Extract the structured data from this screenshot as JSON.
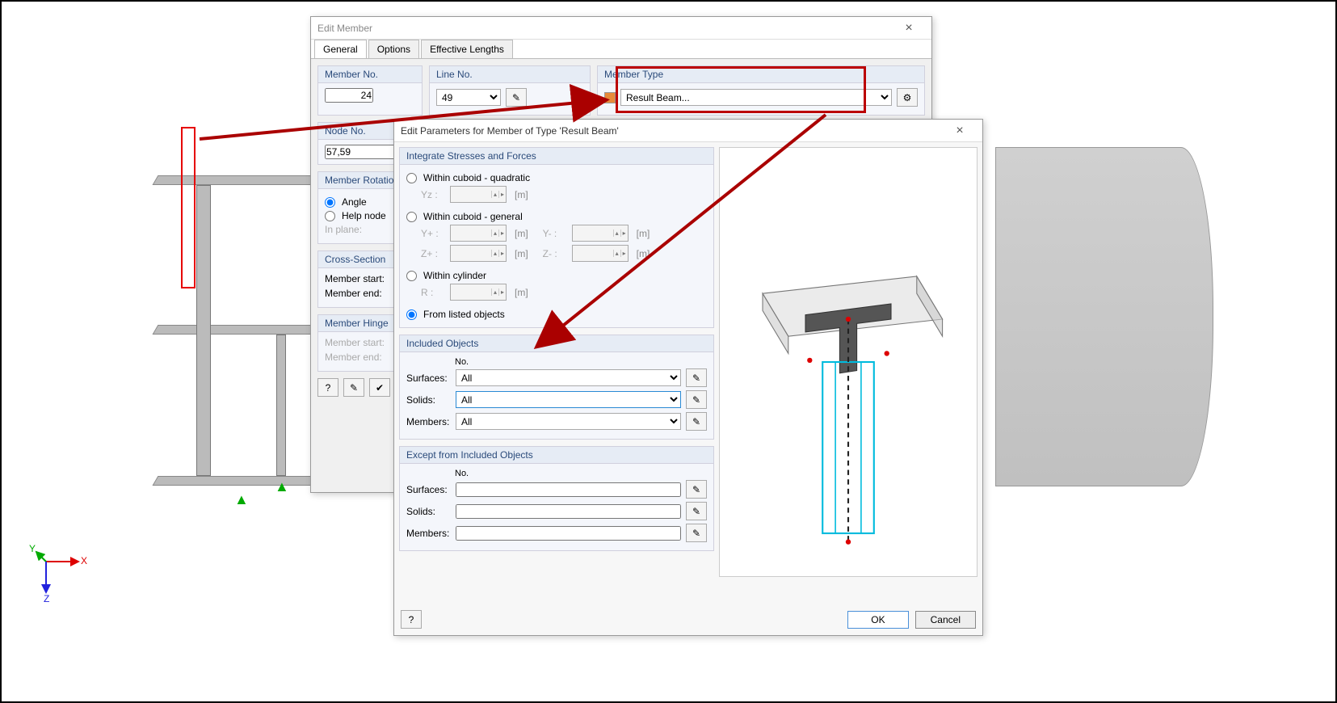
{
  "editMember": {
    "title": "Edit Member",
    "tabs": {
      "general": "General",
      "options": "Options",
      "effective": "Effective Lengths"
    },
    "memberNo": {
      "label": "Member No.",
      "value": "24"
    },
    "lineNo": {
      "label": "Line No.",
      "value": "49"
    },
    "memberType": {
      "label": "Member Type",
      "value": "Result Beam..."
    },
    "nodeNo": {
      "label": "Node No.",
      "value": "57,59"
    },
    "rotation": {
      "title": "Member Rotation",
      "angle": "Angle",
      "helpNode": "Help node",
      "inPlane": "In plane:"
    },
    "crossSection": {
      "title": "Cross-Section",
      "start": "Member start:",
      "end": "Member end:"
    },
    "hinge": {
      "title": "Member Hinge",
      "start": "Member start:",
      "end": "Member end:"
    }
  },
  "editParams": {
    "title": "Edit Parameters for Member of Type 'Result Beam'",
    "integrate": {
      "title": "Integrate Stresses and Forces",
      "quadratic": "Within cuboid - quadratic",
      "yz": "Yz :",
      "general": "Within cuboid - general",
      "yp": "Y+ :",
      "ym": "Y- :",
      "zp": "Z+ :",
      "zm": "Z- :",
      "cylinder": "Within cylinder",
      "r": "R :",
      "listed": "From listed objects"
    },
    "m": "[m]",
    "included": {
      "title": "Included Objects",
      "no": "No.",
      "surfaces": "Surfaces:",
      "solids": "Solids:",
      "members": "Members:",
      "surfacesVal": "All",
      "solidsVal": "All",
      "membersVal": "All"
    },
    "except": {
      "title": "Except from Included Objects",
      "no": "No.",
      "surfaces": "Surfaces:",
      "solids": "Solids:",
      "members": "Members:"
    },
    "ok": "OK",
    "cancel": "Cancel"
  },
  "axes": {
    "x": "X",
    "y": "Y",
    "z": "Z"
  }
}
